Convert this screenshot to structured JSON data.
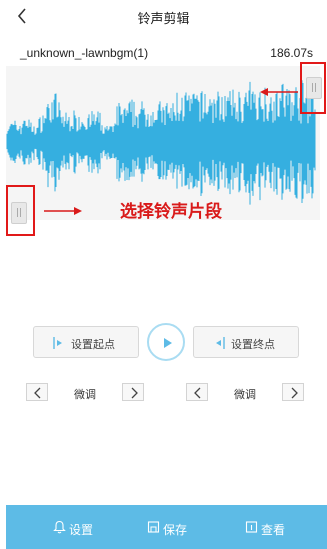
{
  "header": {
    "title": "铃声剪辑",
    "back_icon": "back-chevron-icon"
  },
  "file": {
    "name": "_unknown_-lawnbgm(1)",
    "duration": "186.07s"
  },
  "waveform": {
    "color": "#35afe0",
    "background": "#f5f5f5"
  },
  "annotation": {
    "text": "选择铃声片段",
    "color": "#d91a1a"
  },
  "controls": {
    "set_start_label": "设置起点",
    "set_end_label": "设置终点",
    "play_icon": "play-icon",
    "accent_color": "#5dbbe6"
  },
  "fine_tune": {
    "left": {
      "label": "微调"
    },
    "right": {
      "label": "微调"
    }
  },
  "bottom_nav": {
    "background": "#5dbbe6",
    "items": [
      {
        "label": "设置",
        "icon": "bell-icon"
      },
      {
        "label": "保存",
        "icon": "save-icon"
      },
      {
        "label": "查看",
        "icon": "view-icon"
      }
    ]
  }
}
